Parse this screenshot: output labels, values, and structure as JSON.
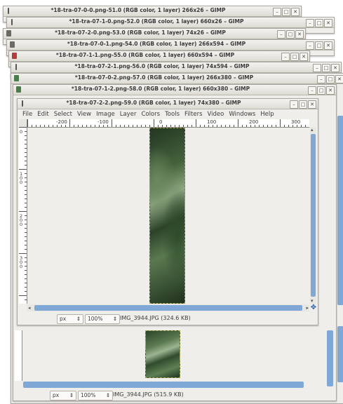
{
  "windows": [
    {
      "title": "*18-tra-07-0-0.png-51.0 (RGB color, 1 layer) 266x26 – GIMP"
    },
    {
      "title": "*18-tra-07-1-0.png-52.0 (RGB color, 1 layer) 660x26 – GIMP"
    },
    {
      "title": "*18-tra-07-2-0.png-53.0 (RGB color, 1 layer) 74x26 – GIMP"
    },
    {
      "title": "*18-tra-07-0-1.png-54.0 (RGB color, 1 layer) 266x594 – GIMP"
    },
    {
      "title": "*18-tra-07-1-1.png-55.0 (RGB color, 1 layer) 660x594 – GIMP"
    },
    {
      "title": "*18-tra-07-2-1.png-56.0 (RGB color, 1 layer) 74x594 – GIMP"
    },
    {
      "title": "*18-tra-07-0-2.png-57.0 (RGB color, 1 layer) 266x380 – GIMP"
    },
    {
      "title": "*18-tra-07-1-2.png-58.0 (RGB color, 1 layer) 660x380 – GIMP"
    }
  ],
  "window_controls": {
    "minimize": "–",
    "maximize": "□",
    "close": "✕"
  },
  "main_window": {
    "title": "*18-tra-07-2-2.png-59.0 (RGB color, 1 layer) 74x380 – GIMP",
    "menu": [
      "File",
      "Edit",
      "Select",
      "View",
      "Image",
      "Layer",
      "Colors",
      "Tools",
      "Filters",
      "Video",
      "Windows",
      "Help"
    ],
    "ruler_labels": [
      "-200",
      "-100",
      "0",
      "100",
      "200",
      "300"
    ],
    "vertical_ruler_labels": [
      "0",
      "100",
      "200",
      "300"
    ],
    "status": {
      "unit": "px",
      "zoom": "100%",
      "file": "IMG_3944.JPG (324.6 KB)"
    }
  },
  "back_window_status": {
    "unit": "px",
    "zoom": "100%",
    "file": "IMG_3944.JPG (515.9 KB)"
  },
  "icons": {
    "navigate": "navigate-icon",
    "nav_glyph": "✥",
    "spinner": "⇕"
  }
}
